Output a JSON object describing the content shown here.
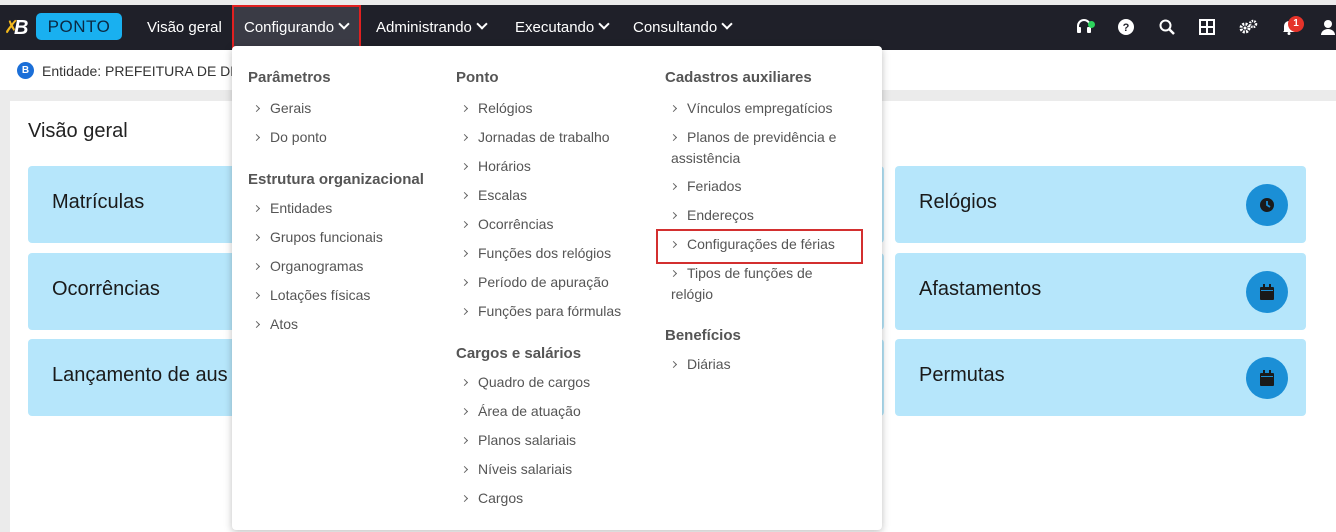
{
  "app": {
    "logo_letter": "B",
    "logo_pill": "PONTO"
  },
  "nav": {
    "items": [
      {
        "label": "Visão geral"
      },
      {
        "label": "Configurando"
      },
      {
        "label": "Administrando"
      },
      {
        "label": "Executando"
      },
      {
        "label": "Consultando"
      }
    ]
  },
  "toolbar": {
    "icons": [
      "headset-icon",
      "help-icon",
      "search-icon",
      "apps-grid-icon",
      "settings-gears-icon",
      "bell-icon",
      "user-icon"
    ],
    "notification_count": "1"
  },
  "entity": {
    "icon_letter": "B",
    "text": "Entidade: PREFEITURA DE DEI"
  },
  "main": {
    "title": "Visão geral",
    "cards": [
      {
        "label": "Matrículas"
      },
      {
        "label": "Ocorrências"
      },
      {
        "label": "Lançamento de aus"
      },
      {
        "label": "Relógios",
        "icon": "clock-icon"
      },
      {
        "label": "Afastamentos",
        "icon": "calendar-icon"
      },
      {
        "label": "Permutas",
        "icon": "calendar-icon"
      }
    ]
  },
  "menu": {
    "parametros": {
      "title": "Parâmetros",
      "items": [
        "Gerais",
        "Do ponto"
      ]
    },
    "estrutura": {
      "title": "Estrutura organizacional",
      "items": [
        "Entidades",
        "Grupos funcionais",
        "Organogramas",
        "Lotações físicas",
        "Atos"
      ]
    },
    "ponto": {
      "title": "Ponto",
      "items": [
        "Relógios",
        "Jornadas de trabalho",
        "Horários",
        "Escalas",
        "Ocorrências",
        "Funções dos relógios",
        "Período de apuração",
        "Funções para fórmulas"
      ]
    },
    "cargos": {
      "title": "Cargos e salários",
      "items": [
        "Quadro de cargos",
        "Área de atuação",
        "Planos salariais",
        "Níveis salariais",
        "Cargos"
      ]
    },
    "cadastros": {
      "title": "Cadastros auxiliares",
      "items": [
        {
          "line1": "Vínculos empregatícios"
        },
        {
          "line1": "Planos de previdência e",
          "line2": "assistência"
        },
        {
          "line1": "Feriados"
        },
        {
          "line1": "Endereços"
        },
        {
          "line1": "Configurações de férias"
        },
        {
          "line1": "Tipos de funções de",
          "line2": "relógio"
        }
      ]
    },
    "beneficios": {
      "title": "Benefícios",
      "items": [
        "Diárias"
      ]
    }
  }
}
